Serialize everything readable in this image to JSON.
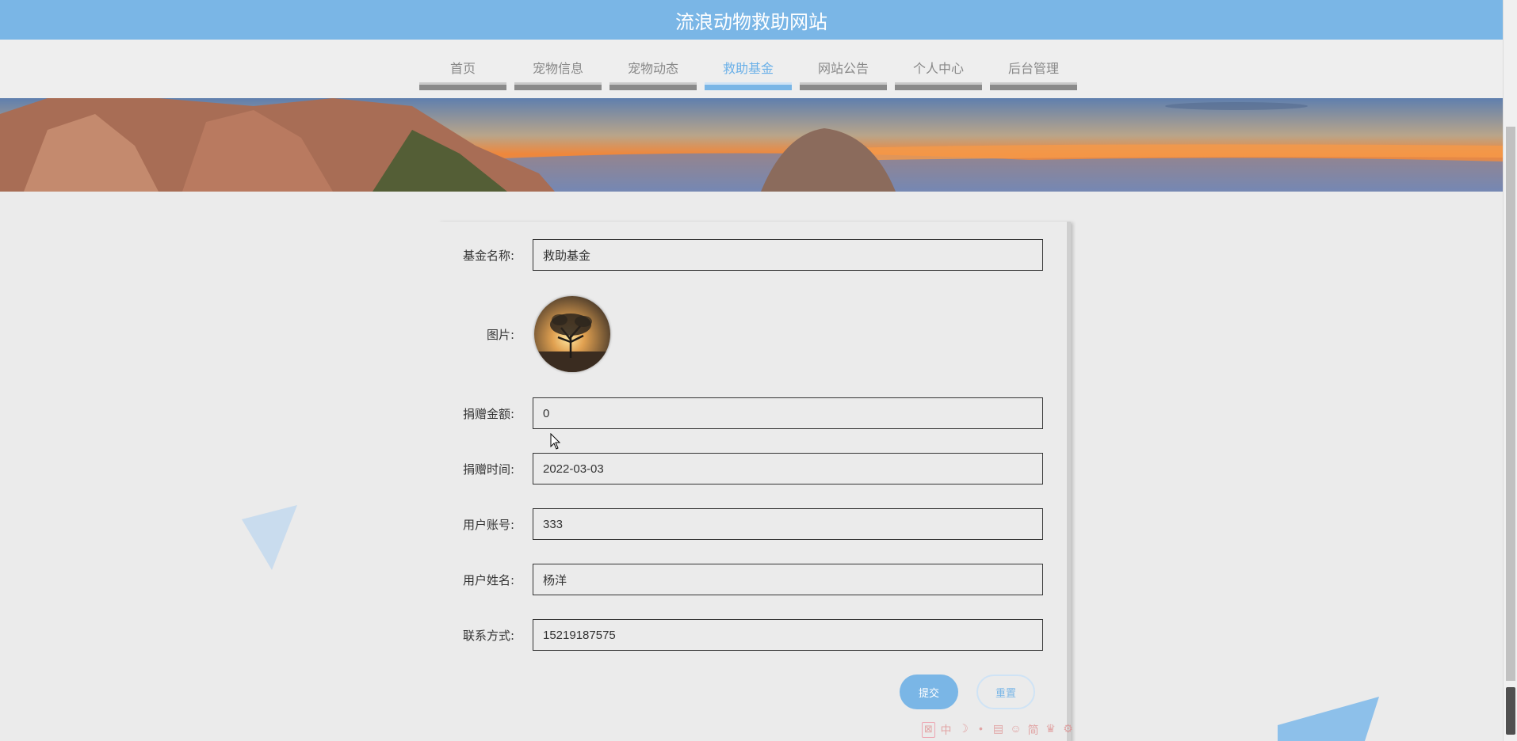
{
  "header": {
    "title": "流浪动物救助网站"
  },
  "nav": {
    "items": [
      {
        "label": "首页"
      },
      {
        "label": "宠物信息"
      },
      {
        "label": "宠物动态"
      },
      {
        "label": "救助基金"
      },
      {
        "label": "网站公告"
      },
      {
        "label": "个人中心"
      },
      {
        "label": "后台管理"
      }
    ],
    "active": "救助基金"
  },
  "form": {
    "fund_name_label": "基金名称:",
    "fund_name_value": "救助基金",
    "image_label": "图片:",
    "amount_label": "捐赠金额:",
    "amount_value": "0",
    "time_label": "捐赠时间:",
    "time_value": "2022-03-03",
    "account_label": "用户账号:",
    "account_value": "333",
    "username_label": "用户姓名:",
    "username_value": "杨洋",
    "contact_label": "联系方式:",
    "contact_value": "15219187575",
    "submit_label": "提交",
    "reset_label": "重置"
  },
  "tray": {
    "icons": [
      "中",
      "☽",
      "•",
      "▤",
      "☺",
      "简",
      "♛",
      "⚙"
    ]
  },
  "colors": {
    "accent": "#7ab6e6",
    "background": "#ebebeb"
  }
}
